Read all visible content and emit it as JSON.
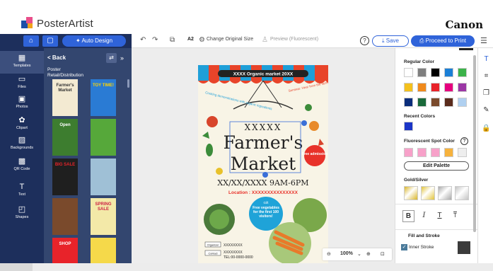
{
  "app": {
    "name": "PosterArtist",
    "brand": "Canon"
  },
  "toolbar": {
    "home_icon": "home-icon",
    "auto_design_label": "Auto Design",
    "paper_size": "A2",
    "change_original_size_label": "Change Original Size",
    "preview_label": "Preview (Fluorescent)",
    "help_label": "?",
    "save_label": "Save",
    "proceed_to_print_label": "Proceed to Print"
  },
  "rail": {
    "items": [
      {
        "label": "Templates",
        "icon": "templates-icon",
        "glyph": "▦",
        "active": true
      },
      {
        "label": "Files",
        "icon": "folder-icon",
        "glyph": "▭"
      },
      {
        "label": "Photos",
        "icon": "image-icon",
        "glyph": "▣"
      },
      {
        "label": "Clipart",
        "icon": "clipart-icon",
        "glyph": "✿"
      },
      {
        "label": "Backgrounds",
        "icon": "background-icon",
        "glyph": "▨"
      },
      {
        "label": "QR Code",
        "icon": "qr-code-icon",
        "glyph": "▩"
      },
      {
        "label": "Text",
        "icon": "text-icon",
        "glyph": "T"
      },
      {
        "label": "Shapes",
        "icon": "shapes-icon",
        "glyph": "◰"
      }
    ]
  },
  "templates_panel": {
    "back_label": "< Back",
    "breadcrumb_1": "Poster",
    "breadcrumb_2": "Retail/Distribution",
    "thumbnails": [
      {
        "text": "Farmer's Market",
        "bg": "#f3ead2",
        "fg": "#333"
      },
      {
        "text": "TOY TIME!",
        "bg": "#2a7bd4",
        "fg": "#ffd400"
      },
      {
        "text": "Open",
        "bg": "#3d7d2f",
        "fg": "#fff"
      },
      {
        "text": "",
        "bg": "#56a83a",
        "fg": "#fff"
      },
      {
        "text": "BIG SALE",
        "bg": "#1f1f1f",
        "fg": "#e8232a"
      },
      {
        "text": "",
        "bg": "#9fc0d6",
        "fg": "#fff"
      },
      {
        "text": "",
        "bg": "#7a4a2c",
        "fg": "#fff"
      },
      {
        "text": "SPRING SALE",
        "bg": "#f3e9a8",
        "fg": "#c24"
      },
      {
        "text": "SHOP",
        "bg": "#e8232a",
        "fg": "#fff"
      },
      {
        "text": "",
        "bg": "#f5d94a",
        "fg": "#333"
      }
    ]
  },
  "poster": {
    "header_banner": "XXXX Organic market 20XX",
    "cooking_demo": "Cooking demonstrations with organic ingredients",
    "seminar": "Seminar: Hear from the farmers",
    "subtitle": "XXXXX",
    "title_line1": "Farmer's",
    "title_line2": "Market",
    "free_admission": "Free admission",
    "date_line": "XX/XX/XXXX 9AM-6PM",
    "location": "Location : XXXXXXXXXXXXXXX",
    "gift_line1": "Gift",
    "gift_line2": "Free vegetables for the first 100 visitors!",
    "organizer_label": "Organizer",
    "organizer_value": "XXXXXXXX",
    "contact_label": "Contact",
    "contact_value": "XXXXXXXX",
    "tel": "TEL:00-0000-0000"
  },
  "zoom": {
    "value": "100%"
  },
  "properties": {
    "regular_color_label": "Regular Color",
    "regular_colors": [
      "#ffffff",
      "#7f7f7f",
      "#000000",
      "#1b7fd6",
      "#3cb34a",
      "#f4c11d",
      "#f08a1c",
      "#e8232a",
      "#e6007e",
      "#9b37a5",
      "#0b2d7b",
      "#1a6a3a",
      "#7a4a2c",
      "#5a2b1c",
      "#b0d0f0"
    ],
    "recent_colors_label": "Recent Colors",
    "recent_colors": [
      "#1b35c7"
    ],
    "fluorescent_label": "Fluorescent Spot Color",
    "fluorescent_colors": [
      "#f7a1c9",
      "#f7a1c9",
      "#f7a1c9",
      "#f6b23d"
    ],
    "edit_palette_label": "Edit Palette",
    "gold_silver_label": "Gold/Silver",
    "gold_silver": [
      "#d9b52a",
      "#e2c43a",
      "#a9a9a9",
      "#c4c4c4"
    ],
    "format_bold": "B",
    "format_italic": "I",
    "format_underline": "T",
    "format_strike": "T",
    "fill_stroke_label": "Fill and Stroke",
    "inner_stroke_label": "Inner Stroke",
    "inner_stroke_color": "#3b3b3b"
  },
  "accent_color": "#2f63d9",
  "sidebar_color": "#1d2f5c"
}
